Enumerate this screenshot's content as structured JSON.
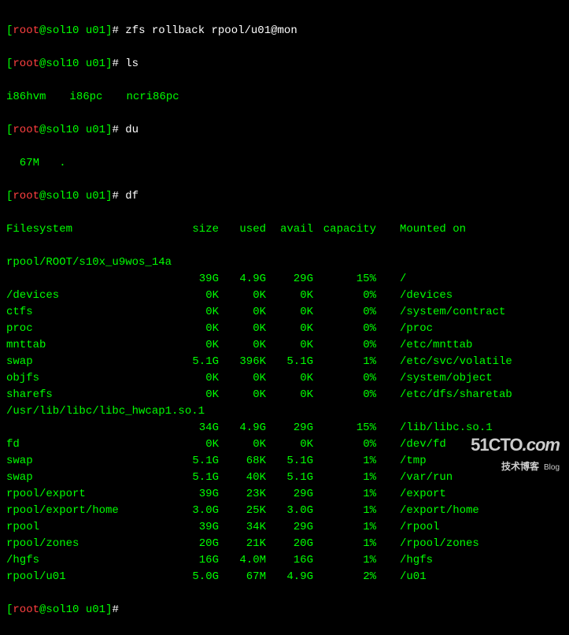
{
  "prompts": [
    {
      "user": "root",
      "host": "sol10",
      "path": "u01",
      "cmd": "zfs rollback rpool/u01@mon"
    },
    {
      "user": "root",
      "host": "sol10",
      "path": "u01",
      "cmd": "ls"
    },
    {
      "user": "root",
      "host": "sol10",
      "path": "u01",
      "cmd": "du"
    },
    {
      "user": "root",
      "host": "sol10",
      "path": "u01",
      "cmd": "df"
    },
    {
      "user": "root",
      "host": "sol10",
      "path": "u01",
      "cmd": ""
    }
  ],
  "ls_output": [
    "i86hvm",
    "i86pc",
    "ncri86pc"
  ],
  "du_output": "  67M   .",
  "df_header": {
    "fs": "Filesystem",
    "size": "size",
    "used": "used",
    "avail": "avail",
    "capacity": "capacity",
    "mount": "Mounted on"
  },
  "df_rows": [
    {
      "fs": "rpool/ROOT/s10x_u9wos_14a",
      "wrap": true
    },
    {
      "fs": "",
      "size": "39G",
      "used": "4.9G",
      "avail": "29G",
      "capacity": "15%",
      "mount": "/"
    },
    {
      "fs": "/devices",
      "size": "0K",
      "used": "0K",
      "avail": "0K",
      "capacity": "0%",
      "mount": "/devices"
    },
    {
      "fs": "ctfs",
      "size": "0K",
      "used": "0K",
      "avail": "0K",
      "capacity": "0%",
      "mount": "/system/contract"
    },
    {
      "fs": "proc",
      "size": "0K",
      "used": "0K",
      "avail": "0K",
      "capacity": "0%",
      "mount": "/proc"
    },
    {
      "fs": "mnttab",
      "size": "0K",
      "used": "0K",
      "avail": "0K",
      "capacity": "0%",
      "mount": "/etc/mnttab"
    },
    {
      "fs": "swap",
      "size": "5.1G",
      "used": "396K",
      "avail": "5.1G",
      "capacity": "1%",
      "mount": "/etc/svc/volatile"
    },
    {
      "fs": "objfs",
      "size": "0K",
      "used": "0K",
      "avail": "0K",
      "capacity": "0%",
      "mount": "/system/object"
    },
    {
      "fs": "sharefs",
      "size": "0K",
      "used": "0K",
      "avail": "0K",
      "capacity": "0%",
      "mount": "/etc/dfs/sharetab"
    },
    {
      "fs": "/usr/lib/libc/libc_hwcap1.so.1",
      "wrap": true
    },
    {
      "fs": "",
      "size": "34G",
      "used": "4.9G",
      "avail": "29G",
      "capacity": "15%",
      "mount": "/lib/libc.so.1"
    },
    {
      "fs": "fd",
      "size": "0K",
      "used": "0K",
      "avail": "0K",
      "capacity": "0%",
      "mount": "/dev/fd"
    },
    {
      "fs": "swap",
      "size": "5.1G",
      "used": "68K",
      "avail": "5.1G",
      "capacity": "1%",
      "mount": "/tmp"
    },
    {
      "fs": "swap",
      "size": "5.1G",
      "used": "40K",
      "avail": "5.1G",
      "capacity": "1%",
      "mount": "/var/run"
    },
    {
      "fs": "rpool/export",
      "size": "39G",
      "used": "23K",
      "avail": "29G",
      "capacity": "1%",
      "mount": "/export"
    },
    {
      "fs": "rpool/export/home",
      "size": "3.0G",
      "used": "25K",
      "avail": "3.0G",
      "capacity": "1%",
      "mount": "/export/home"
    },
    {
      "fs": "rpool",
      "size": "39G",
      "used": "34K",
      "avail": "29G",
      "capacity": "1%",
      "mount": "/rpool"
    },
    {
      "fs": "rpool/zones",
      "size": "20G",
      "used": "21K",
      "avail": "20G",
      "capacity": "1%",
      "mount": "/rpool/zones"
    },
    {
      "fs": "/hgfs",
      "size": "16G",
      "used": "4.0M",
      "avail": "16G",
      "capacity": "1%",
      "mount": "/hgfs"
    },
    {
      "fs": "rpool/u01",
      "size": "5.0G",
      "used": "67M",
      "avail": "4.9G",
      "capacity": "2%",
      "mount": "/u01"
    }
  ],
  "watermark": {
    "site": "51CTO",
    "domain": ".com",
    "sub": "技术博客",
    "blog": "Blog"
  }
}
